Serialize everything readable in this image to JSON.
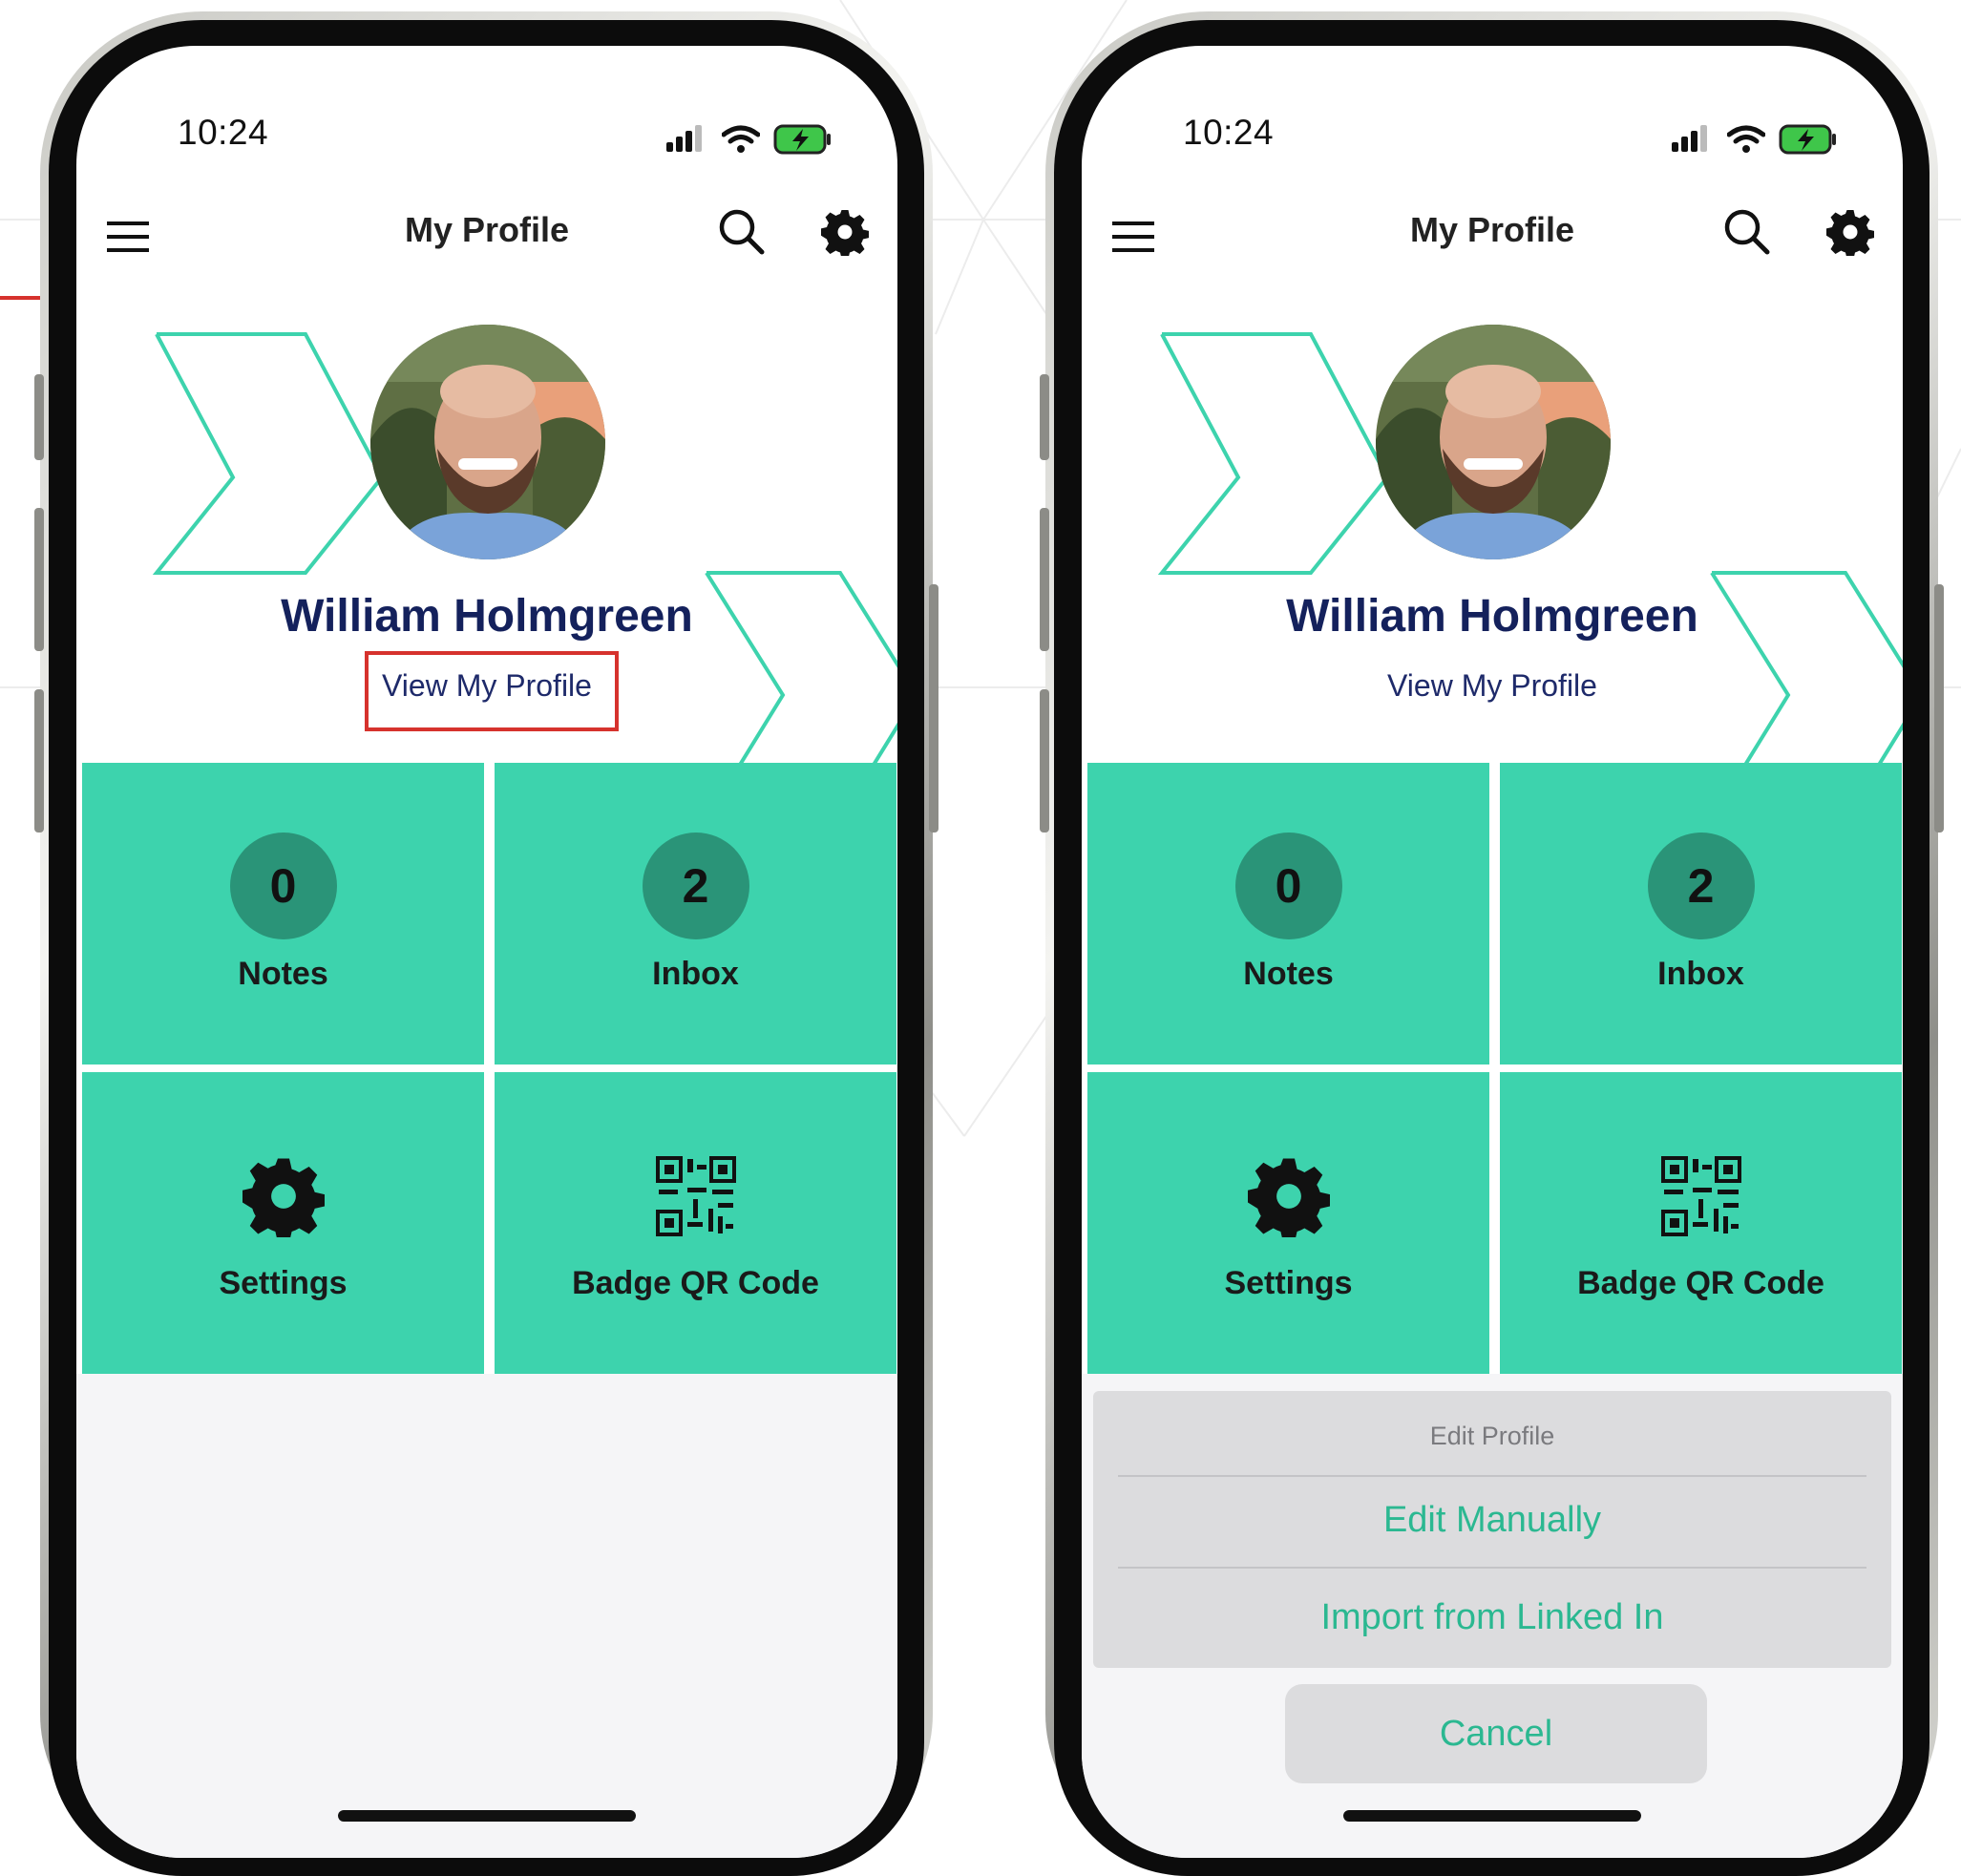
{
  "phones": [
    {
      "status": {
        "time": "10:24"
      },
      "nav": {
        "title": "My Profile"
      },
      "profile": {
        "name": "William Holmgreen",
        "link": "View My Profile"
      },
      "tiles": [
        {
          "count": "0",
          "label": "Notes"
        },
        {
          "count": "2",
          "label": "Inbox"
        },
        {
          "label": "Settings",
          "icon": "gear-icon"
        },
        {
          "label": "Badge QR Code",
          "icon": "qr-code-icon"
        }
      ]
    },
    {
      "status": {
        "time": "10:24"
      },
      "nav": {
        "title": "My Profile"
      },
      "profile": {
        "name": "William Holmgreen",
        "link": "View My Profile"
      },
      "tiles": [
        {
          "count": "0",
          "label": "Notes"
        },
        {
          "count": "2",
          "label": "Inbox"
        },
        {
          "label": "Settings",
          "icon": "gear-icon"
        },
        {
          "label": "Badge QR Code",
          "icon": "qr-code-icon"
        }
      ],
      "action_sheet": {
        "title": "Edit Profile",
        "items": [
          "Edit Manually",
          "Import from Linked In"
        ],
        "cancel": "Cancel"
      }
    }
  ],
  "colors": {
    "tile": "#3dd3ad",
    "badge": "#2a9478",
    "accent_text": "#2bb891",
    "name_text": "#14215c",
    "callout": "#d6322d"
  }
}
